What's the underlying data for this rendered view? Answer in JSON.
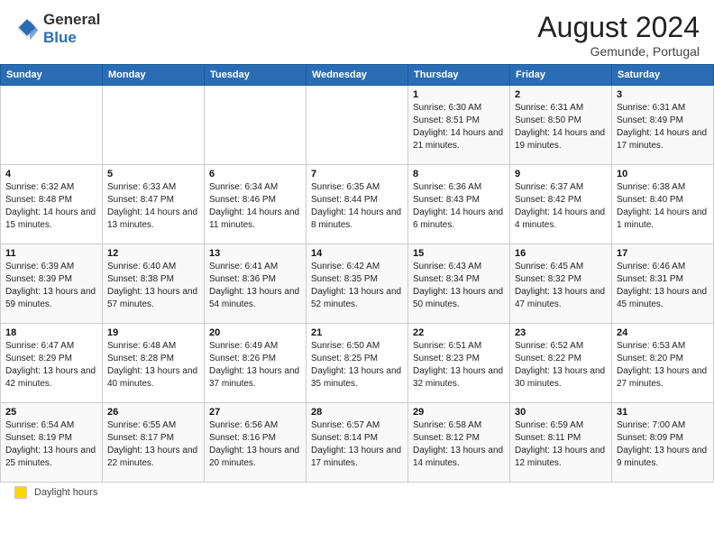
{
  "header": {
    "logo_general": "General",
    "logo_blue": "Blue",
    "month_year": "August 2024",
    "location": "Gemunde, Portugal"
  },
  "days_of_week": [
    "Sunday",
    "Monday",
    "Tuesday",
    "Wednesday",
    "Thursday",
    "Friday",
    "Saturday"
  ],
  "legend_label": "Daylight hours",
  "weeks": [
    [
      {
        "day": "",
        "info": ""
      },
      {
        "day": "",
        "info": ""
      },
      {
        "day": "",
        "info": ""
      },
      {
        "day": "",
        "info": ""
      },
      {
        "day": "1",
        "info": "Sunrise: 6:30 AM\nSunset: 8:51 PM\nDaylight: 14 hours and 21 minutes."
      },
      {
        "day": "2",
        "info": "Sunrise: 6:31 AM\nSunset: 8:50 PM\nDaylight: 14 hours and 19 minutes."
      },
      {
        "day": "3",
        "info": "Sunrise: 6:31 AM\nSunset: 8:49 PM\nDaylight: 14 hours and 17 minutes."
      }
    ],
    [
      {
        "day": "4",
        "info": "Sunrise: 6:32 AM\nSunset: 8:48 PM\nDaylight: 14 hours and 15 minutes."
      },
      {
        "day": "5",
        "info": "Sunrise: 6:33 AM\nSunset: 8:47 PM\nDaylight: 14 hours and 13 minutes."
      },
      {
        "day": "6",
        "info": "Sunrise: 6:34 AM\nSunset: 8:46 PM\nDaylight: 14 hours and 11 minutes."
      },
      {
        "day": "7",
        "info": "Sunrise: 6:35 AM\nSunset: 8:44 PM\nDaylight: 14 hours and 8 minutes."
      },
      {
        "day": "8",
        "info": "Sunrise: 6:36 AM\nSunset: 8:43 PM\nDaylight: 14 hours and 6 minutes."
      },
      {
        "day": "9",
        "info": "Sunrise: 6:37 AM\nSunset: 8:42 PM\nDaylight: 14 hours and 4 minutes."
      },
      {
        "day": "10",
        "info": "Sunrise: 6:38 AM\nSunset: 8:40 PM\nDaylight: 14 hours and 1 minute."
      }
    ],
    [
      {
        "day": "11",
        "info": "Sunrise: 6:39 AM\nSunset: 8:39 PM\nDaylight: 13 hours and 59 minutes."
      },
      {
        "day": "12",
        "info": "Sunrise: 6:40 AM\nSunset: 8:38 PM\nDaylight: 13 hours and 57 minutes."
      },
      {
        "day": "13",
        "info": "Sunrise: 6:41 AM\nSunset: 8:36 PM\nDaylight: 13 hours and 54 minutes."
      },
      {
        "day": "14",
        "info": "Sunrise: 6:42 AM\nSunset: 8:35 PM\nDaylight: 13 hours and 52 minutes."
      },
      {
        "day": "15",
        "info": "Sunrise: 6:43 AM\nSunset: 8:34 PM\nDaylight: 13 hours and 50 minutes."
      },
      {
        "day": "16",
        "info": "Sunrise: 6:45 AM\nSunset: 8:32 PM\nDaylight: 13 hours and 47 minutes."
      },
      {
        "day": "17",
        "info": "Sunrise: 6:46 AM\nSunset: 8:31 PM\nDaylight: 13 hours and 45 minutes."
      }
    ],
    [
      {
        "day": "18",
        "info": "Sunrise: 6:47 AM\nSunset: 8:29 PM\nDaylight: 13 hours and 42 minutes."
      },
      {
        "day": "19",
        "info": "Sunrise: 6:48 AM\nSunset: 8:28 PM\nDaylight: 13 hours and 40 minutes."
      },
      {
        "day": "20",
        "info": "Sunrise: 6:49 AM\nSunset: 8:26 PM\nDaylight: 13 hours and 37 minutes."
      },
      {
        "day": "21",
        "info": "Sunrise: 6:50 AM\nSunset: 8:25 PM\nDaylight: 13 hours and 35 minutes."
      },
      {
        "day": "22",
        "info": "Sunrise: 6:51 AM\nSunset: 8:23 PM\nDaylight: 13 hours and 32 minutes."
      },
      {
        "day": "23",
        "info": "Sunrise: 6:52 AM\nSunset: 8:22 PM\nDaylight: 13 hours and 30 minutes."
      },
      {
        "day": "24",
        "info": "Sunrise: 6:53 AM\nSunset: 8:20 PM\nDaylight: 13 hours and 27 minutes."
      }
    ],
    [
      {
        "day": "25",
        "info": "Sunrise: 6:54 AM\nSunset: 8:19 PM\nDaylight: 13 hours and 25 minutes."
      },
      {
        "day": "26",
        "info": "Sunrise: 6:55 AM\nSunset: 8:17 PM\nDaylight: 13 hours and 22 minutes."
      },
      {
        "day": "27",
        "info": "Sunrise: 6:56 AM\nSunset: 8:16 PM\nDaylight: 13 hours and 20 minutes."
      },
      {
        "day": "28",
        "info": "Sunrise: 6:57 AM\nSunset: 8:14 PM\nDaylight: 13 hours and 17 minutes."
      },
      {
        "day": "29",
        "info": "Sunrise: 6:58 AM\nSunset: 8:12 PM\nDaylight: 13 hours and 14 minutes."
      },
      {
        "day": "30",
        "info": "Sunrise: 6:59 AM\nSunset: 8:11 PM\nDaylight: 13 hours and 12 minutes."
      },
      {
        "day": "31",
        "info": "Sunrise: 7:00 AM\nSunset: 8:09 PM\nDaylight: 13 hours and 9 minutes."
      }
    ]
  ]
}
